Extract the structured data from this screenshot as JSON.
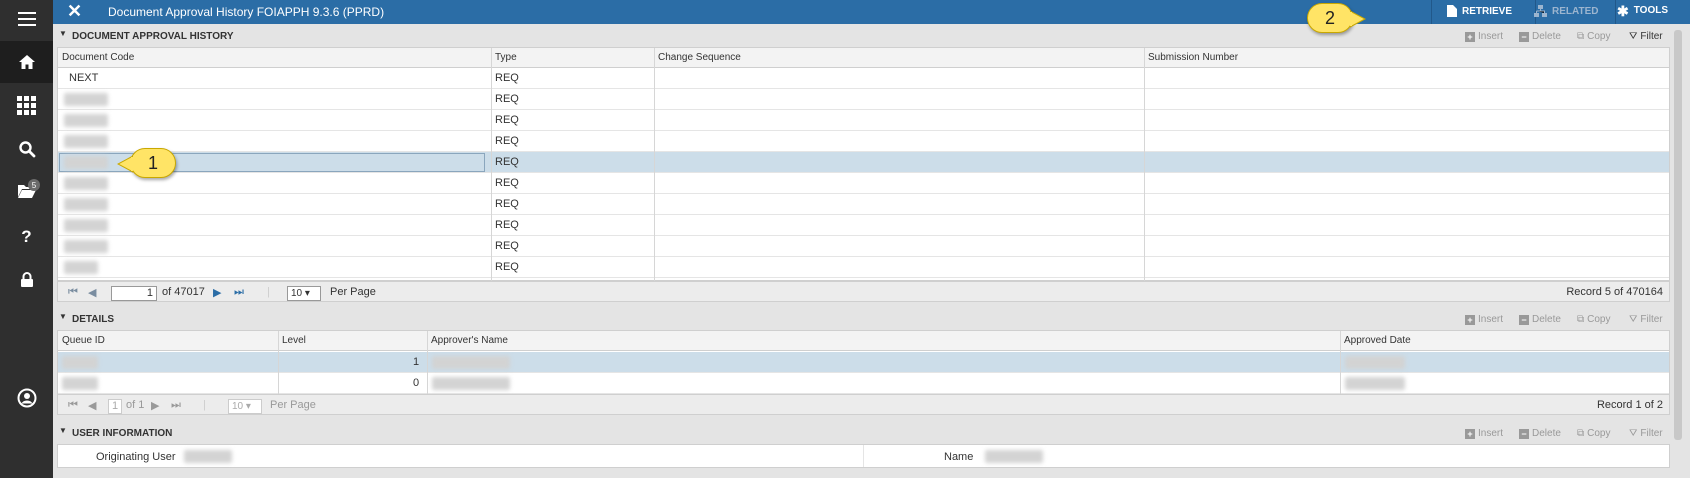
{
  "app": {
    "title": "Document Approval History FOIAPPH 9.3.6 (PPRD)",
    "close_label": "✕",
    "toolbar": {
      "retrieve": "RETRIEVE",
      "related": "RELATED",
      "tools": "TOOLS"
    },
    "accent": "#2b6da6"
  },
  "nav": {
    "folder_badge": "5"
  },
  "section_actions": {
    "insert": "Insert",
    "delete": "Delete",
    "copy": "Copy",
    "filter": "Filter"
  },
  "doc_history": {
    "title": "DOCUMENT APPROVAL HISTORY",
    "columns": [
      "Document Code",
      "Type",
      "Change Sequence",
      "Submission Number"
    ],
    "rows": [
      {
        "code": "NEXT",
        "type": "REQ"
      },
      {
        "code": "",
        "type": "REQ"
      },
      {
        "code": "",
        "type": "REQ"
      },
      {
        "code": "",
        "type": "REQ"
      },
      {
        "code": "",
        "type": "REQ"
      },
      {
        "code": "",
        "type": "REQ"
      },
      {
        "code": "",
        "type": "REQ"
      },
      {
        "code": "",
        "type": "REQ"
      },
      {
        "code": "",
        "type": "REQ"
      },
      {
        "code": "",
        "type": "REQ"
      }
    ],
    "selected_row": 5,
    "pager": {
      "page": "1",
      "of_pages": "of 47017",
      "per_page": "10",
      "per_page_label": "Per Page",
      "record": "Record 5 of 470164"
    }
  },
  "details": {
    "title": "DETAILS",
    "columns": [
      "Queue ID",
      "Level",
      "Approver's Name",
      "Approved Date"
    ],
    "rows": [
      {
        "level": "1"
      },
      {
        "level": "0"
      }
    ],
    "pager": {
      "page": "1",
      "of_pages": "of 1",
      "per_page": "10",
      "per_page_label": "Per Page",
      "record": "Record 1 of 2"
    }
  },
  "user_info": {
    "title": "USER INFORMATION",
    "originating_user_label": "Originating User",
    "name_label": "Name"
  },
  "callouts": {
    "one": "1",
    "two": "2"
  }
}
